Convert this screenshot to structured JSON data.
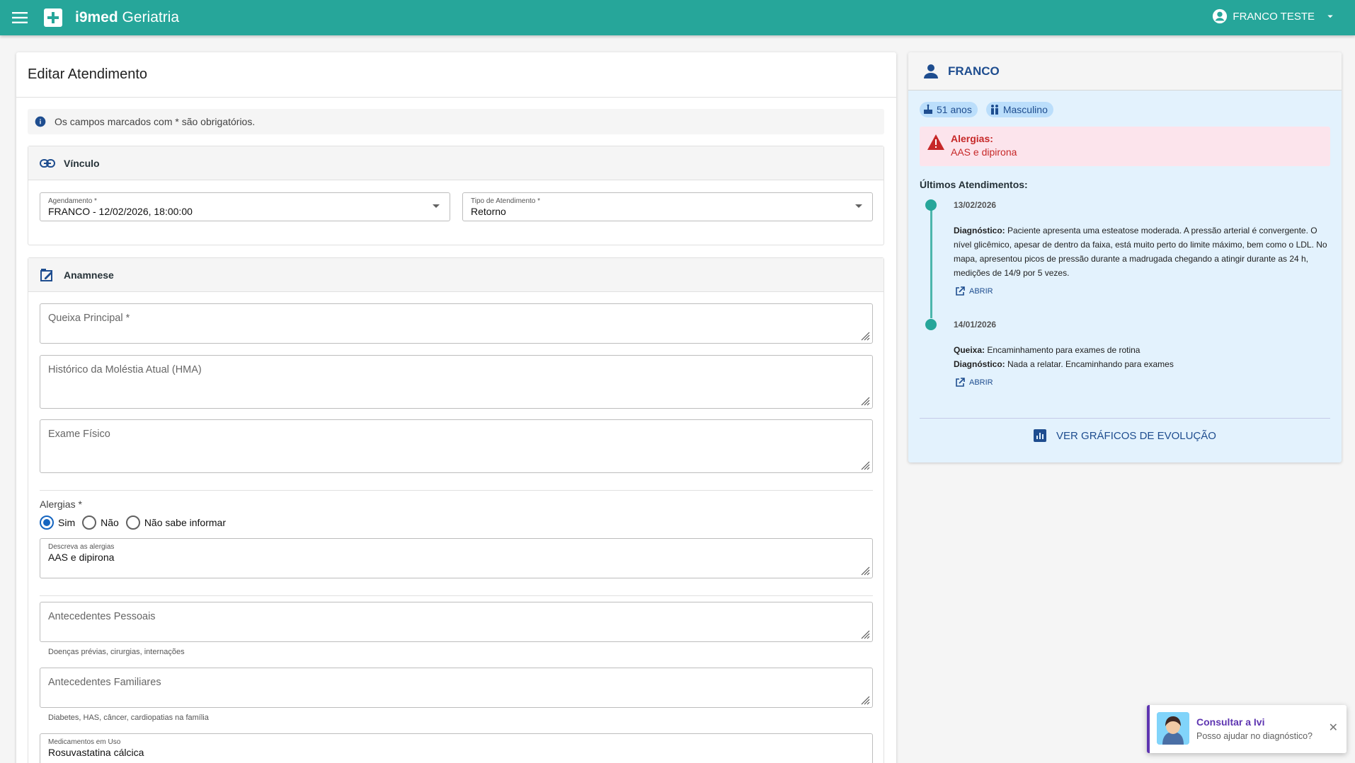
{
  "appbar": {
    "brand_bold": "i9med",
    "brand_rest": " Geriatria",
    "user_name": "FRANCO TESTE",
    "menu_icon": "menu-icon",
    "user_icon": "account-circle-icon"
  },
  "form": {
    "title": "Editar Atendimento",
    "info_note": "Os campos marcados com * são obrigatórios.",
    "vinculo": {
      "title": "Vínculo",
      "agendamento_label": "Agendamento *",
      "agendamento_value": "FRANCO - 12/02/2026, 18:00:00",
      "tipo_label": "Tipo de Atendimento *",
      "tipo_value": "Retorno"
    },
    "anamnese": {
      "title": "Anamnese",
      "queixa_label": "Queixa Principal *",
      "hma_label": "Histórico da Moléstia Atual (HMA)",
      "exame_label": "Exame Físico",
      "alergias_label": "Alergias *",
      "radio_sim": "Sim",
      "radio_nao": "Não",
      "radio_nao_sabe": "Não sabe informar",
      "alergias_desc_label": "Descreva as alergias",
      "alergias_desc_value": "AAS e dipirona",
      "antecedentes_pessoais_label": "Antecedentes Pessoais",
      "antecedentes_pessoais_hint": "Doenças prévias, cirurgias, internações",
      "antecedentes_familiares_label": "Antecedentes Familiares",
      "antecedentes_familiares_hint": "Diabetes, HAS, câncer, cardiopatias na família",
      "medicamentos_label": "Medicamentos em Uso",
      "medicamentos_value": "Rosuvastatina cálcica"
    }
  },
  "patient": {
    "name": "FRANCO",
    "age": "51 anos",
    "sex": "Masculino",
    "allergy_title": "Alergias:",
    "allergy_value": "AAS e dipirona",
    "history_title": "Últimos Atendimentos:",
    "history": [
      {
        "date": "13/02/2026",
        "diag_label": "Diagnóstico:",
        "diag_text": " Paciente apresenta uma esteatose moderada. A pressão arterial é convergente. O nível glicêmico, apesar de dentro da faixa, está muito perto do limite máximo, bem como o LDL. No mapa, apresentou picos de pressão durante a madrugada chegando a atingir durante as 24 h, medições de 14/9 por 5 vezes.",
        "open_label": "ABRIR"
      },
      {
        "date": "14/01/2026",
        "queixa_label": "Queixa:",
        "queixa_text": " Encaminhamento para exames de rotina",
        "diag_label": "Diagnóstico:",
        "diag_text": " Nada a relatar. Encaminhando para exames",
        "open_label": "ABRIR"
      }
    ],
    "graphs_label": "VER GRÁFICOS DE EVOLUÇÃO"
  },
  "assistant": {
    "title": "Consultar a Ivi",
    "subtitle": "Posso ajudar no diagnóstico?",
    "close": "✕"
  },
  "colors": {
    "primary": "#26a69a",
    "accent_blue": "#1e4d8f",
    "danger": "#c62828",
    "assistant": "#5e35b1"
  }
}
